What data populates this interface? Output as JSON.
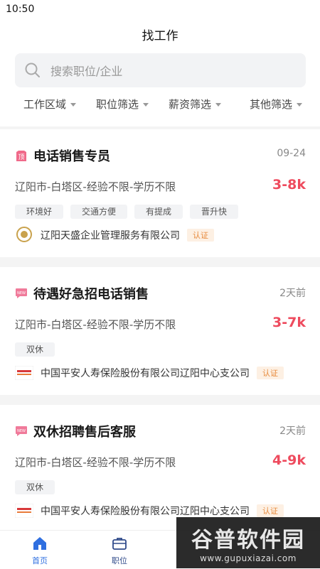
{
  "status": {
    "time": "10:50"
  },
  "header": {
    "title": "找工作",
    "search_placeholder": "搜索职位/企业",
    "filters": [
      "工作区域",
      "职位筛选",
      "薪资筛选",
      "其他筛选"
    ]
  },
  "jobs": [
    {
      "title": "电话销售专员",
      "badge": "顶",
      "date": "09-24",
      "meta": "辽阳市-白塔区-经验不限-学历不限",
      "salary": "3-8k",
      "tags": [
        "环境好",
        "交通方便",
        "有提成",
        "晋升快"
      ],
      "company": "辽阳天盛企业管理服务有限公司",
      "verified": "认证"
    },
    {
      "title": "待遇好急招电话销售",
      "badge": "NEW",
      "date": "2天前",
      "meta": "辽阳市-白塔区-经验不限-学历不限",
      "salary": "3-7k",
      "tags": [
        "双休"
      ],
      "company": "中国平安人寿保险股份有限公司辽阳中心支公司",
      "verified": "认证"
    },
    {
      "title": "双休招聘售后客服",
      "badge": "NEW",
      "date": "2天前",
      "meta": "辽阳市-白塔区-经验不限-学历不限",
      "salary": "4-9k",
      "tags": [
        "双休"
      ],
      "company": "中国平安人寿保险股份有限公司辽阳中心支公司",
      "verified": "认证"
    }
  ],
  "tabbar": {
    "home": "首页",
    "jobs": "职位"
  },
  "watermark": {
    "brand": "谷普软件园",
    "url": "www.gupuxiazai.com"
  },
  "colors": {
    "accent": "#2f6fe0",
    "salary": "#ee4b5e",
    "verify": "#e78a3c"
  }
}
